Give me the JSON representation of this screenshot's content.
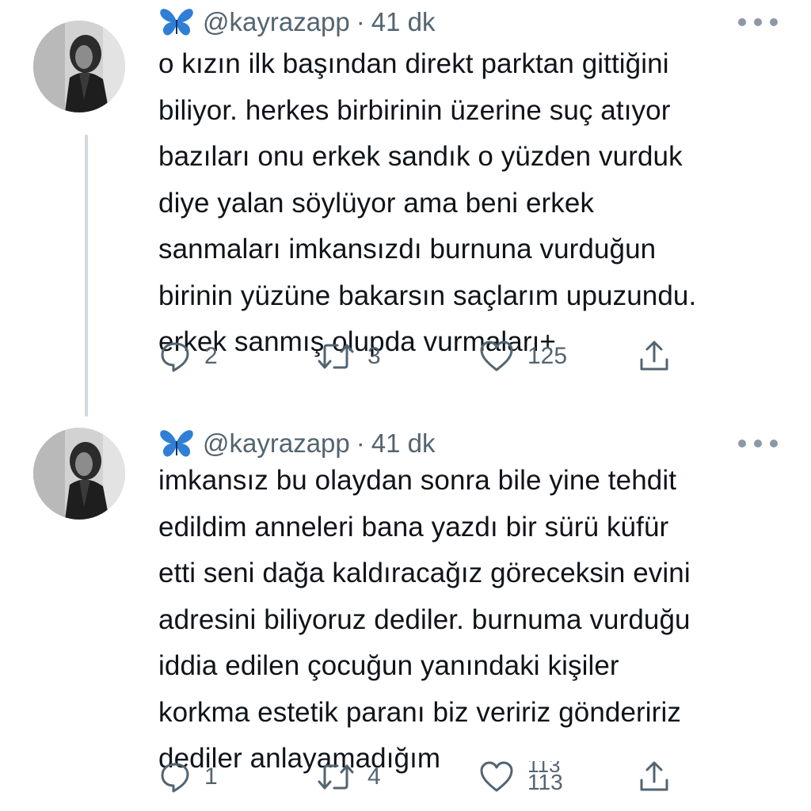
{
  "tweets": [
    {
      "handle": "@kayrazapp",
      "separator": "·",
      "time": "41 dk",
      "lines": [
        "o kızın ilk başından direkt parktan gittiğini",
        "biliyor. herkes birbirinin üzerine suç atıyor",
        "bazıları onu erkek sandık o yüzden vurduk",
        "diye yalan söylüyor ama beni erkek",
        "sanmaları imkansızdı burnuna vurduğun",
        "birinin yüzüne bakarsın saçlarım upuzundu.",
        "erkek sanmış olupda vurmaları+"
      ],
      "replies": "2",
      "retweets": "3",
      "likes": "125"
    },
    {
      "handle": "@kayrazapp",
      "separator": "·",
      "time": "41 dk",
      "lines": [
        "imkansız bu olaydan sonra bile yine tehdit",
        "edildim anneleri bana yazdı bir sürü küfür",
        "etti seni dağa kaldıracağız göreceksin evini",
        "adresini biliyoruz dediler. burnuma vurduğu",
        "iddia edilen çocuğun yanındaki kişiler",
        "korkma estetik paranı biz veririz göndeririz",
        "dediler anlayamadığım"
      ],
      "replies": "1",
      "retweets": "4",
      "likes_prev": "113",
      "likes": "113"
    }
  ],
  "icons": {
    "verified_emoji": "butterfly-icon",
    "more": "more-dots-icon",
    "reply": "reply-icon",
    "retweet": "retweet-icon",
    "like": "heart-icon",
    "share": "share-icon"
  },
  "colors": {
    "text": "#0f1419",
    "muted": "#536471",
    "butterfly": "#2f7fd6",
    "thread_line": "#cfd9de"
  }
}
